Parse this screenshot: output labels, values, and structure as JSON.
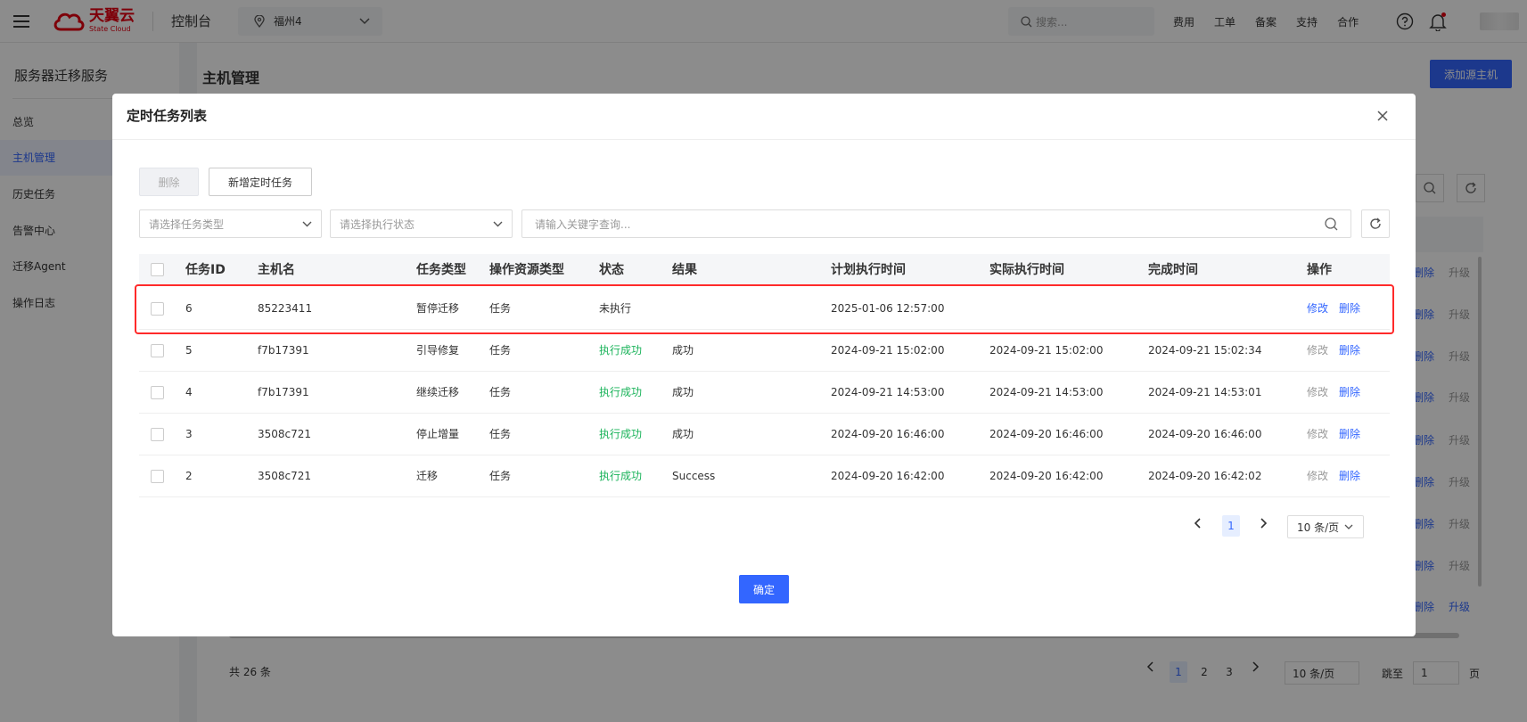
{
  "topbar": {
    "logo_cn": "天翼云",
    "logo_en": "State Cloud",
    "console": "控制台",
    "region": "福州4",
    "search_placeholder": "搜索...",
    "links": [
      "费用",
      "工单",
      "备案",
      "支持",
      "合作"
    ]
  },
  "sidebar": {
    "title": "服务器迁移服务",
    "items": [
      {
        "label": "总览"
      },
      {
        "label": "主机管理"
      },
      {
        "label": "历史任务"
      },
      {
        "label": "告警中心"
      },
      {
        "label": "迁移Agent"
      },
      {
        "label": "操作日志"
      }
    ]
  },
  "background": {
    "title": "主机管理",
    "add_button": "添加源主机",
    "row_delete": "删除",
    "row_upgrade": "升级",
    "total": "共 26 条",
    "pages": [
      "1",
      "2",
      "3"
    ],
    "page_size": "10 条/页",
    "jump_label": "跳至",
    "jump_value": "1",
    "jump_unit": "页"
  },
  "modal": {
    "title": "定时任务列表",
    "delete_button": "删除",
    "new_button": "新增定时任务",
    "task_type_placeholder": "请选择任务类型",
    "exec_status_placeholder": "请选择执行状态",
    "keyword_placeholder": "请输入关键字查询...",
    "columns": [
      "任务ID",
      "主机名",
      "任务类型",
      "操作资源类型",
      "状态",
      "结果",
      "计划执行时间",
      "实际执行时间",
      "完成时间",
      "操作"
    ],
    "rows": [
      {
        "id": "6",
        "host": "85223411",
        "type": "暂停迁移",
        "res": "任务",
        "status": "未执行",
        "result": "",
        "plan": "2025-01-06 12:57:00",
        "actual": "",
        "done": "",
        "edit": "修改",
        "delete": "删除",
        "status_color": "#333333",
        "edit_enabled": true
      },
      {
        "id": "5",
        "host": "f7b17391",
        "type": "引导修复",
        "res": "任务",
        "status": "执行成功",
        "result": "成功",
        "plan": "2024-09-21 15:02:00",
        "actual": "2024-09-21 15:02:00",
        "done": "2024-09-21 15:02:34",
        "edit": "修改",
        "delete": "删除",
        "status_color": "#1ab35a",
        "edit_enabled": false
      },
      {
        "id": "4",
        "host": "f7b17391",
        "type": "继续迁移",
        "res": "任务",
        "status": "执行成功",
        "result": "成功",
        "plan": "2024-09-21 14:53:00",
        "actual": "2024-09-21 14:53:00",
        "done": "2024-09-21 14:53:01",
        "edit": "修改",
        "delete": "删除",
        "status_color": "#1ab35a",
        "edit_enabled": false
      },
      {
        "id": "3",
        "host": "3508c721",
        "type": "停止增量",
        "res": "任务",
        "status": "执行成功",
        "result": "成功",
        "plan": "2024-09-20 16:46:00",
        "actual": "2024-09-20 16:46:00",
        "done": "2024-09-20 16:46:00",
        "edit": "修改",
        "delete": "删除",
        "status_color": "#1ab35a",
        "edit_enabled": false
      },
      {
        "id": "2",
        "host": "3508c721",
        "type": "迁移",
        "res": "任务",
        "status": "执行成功",
        "result": "Success",
        "plan": "2024-09-20 16:42:00",
        "actual": "2024-09-20 16:42:00",
        "done": "2024-09-20 16:42:02",
        "edit": "修改",
        "delete": "删除",
        "status_color": "#1ab35a",
        "edit_enabled": false
      }
    ],
    "current_page": "1",
    "page_size": "10 条/页",
    "ok_button": "确定"
  },
  "colors": {
    "accent": "#3366ff",
    "success": "#1ab35a",
    "highlight": "#ff2a2a",
    "brand": "#e60012"
  }
}
